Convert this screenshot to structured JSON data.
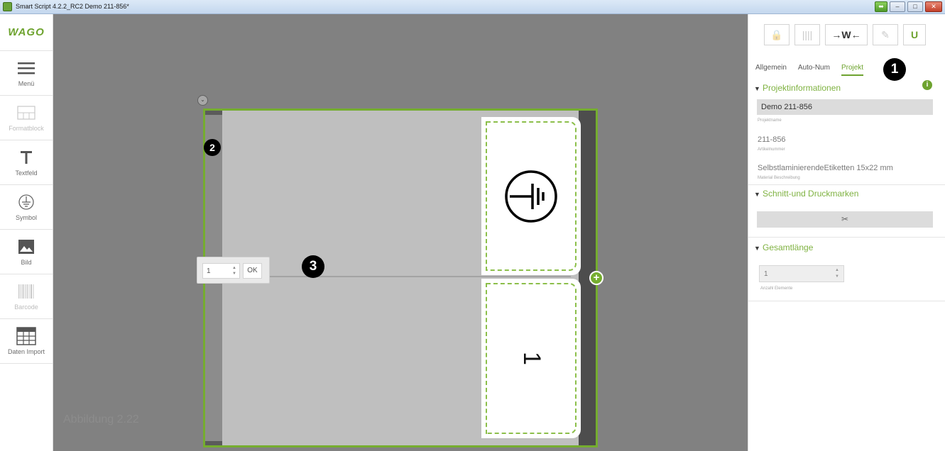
{
  "window": {
    "title": "Smart Script 4.2.2_RC2  Demo 211-856*",
    "buttons": {
      "min": "–",
      "max": "□",
      "close": "✕"
    }
  },
  "left_toolbar": {
    "logo": "WAGO",
    "tools": [
      {
        "label": "Menü",
        "icon": "hamburger-icon",
        "enabled": true
      },
      {
        "label": "Formatblock",
        "icon": "formatblock-icon",
        "enabled": false
      },
      {
        "label": "Textfeld",
        "icon": "text-icon",
        "enabled": true
      },
      {
        "label": "Symbol",
        "icon": "earth-symbol-icon",
        "enabled": true
      },
      {
        "label": "Bild",
        "icon": "image-icon",
        "enabled": true
      },
      {
        "label": "Barcode",
        "icon": "barcode-icon",
        "enabled": false
      },
      {
        "label": "Daten Import",
        "icon": "table-icon",
        "enabled": true
      }
    ]
  },
  "canvas": {
    "watermark": "Abbildung 2.22",
    "card_bottom_text": "1",
    "stepper": {
      "value": "1",
      "ok_label": "OK"
    },
    "callouts": {
      "two": "2",
      "three": "3"
    }
  },
  "right_panel": {
    "toolbar": {
      "lock": "🔒",
      "columns": "||||",
      "fit": "→W←",
      "wand": "✎",
      "magnet": "U"
    },
    "tabs": [
      {
        "label": "Allgemein",
        "active": false
      },
      {
        "label": "Auto-Num",
        "active": false
      },
      {
        "label": "Projekt",
        "active": true
      }
    ],
    "callout_one": "1",
    "project_info": {
      "header": "Projektinformationen",
      "project_name": "Demo 211-856",
      "project_name_label": "Projektname",
      "article_number": "211-856",
      "article_number_label": "Artikelnummer",
      "material": "SelbstlaminierendeEtiketten 15x22 mm",
      "material_label": "Material Beschreibung"
    },
    "cut_marks": {
      "header": "Schnitt-und Druckmarken",
      "button_icon": "✂"
    },
    "total_length": {
      "header": "Gesamtlänge",
      "value": "1",
      "label": "Anzahl Elemente"
    }
  },
  "colors": {
    "accent": "#75ad2f",
    "canvas": "#818181",
    "label_bg": "#bfbfbf"
  }
}
